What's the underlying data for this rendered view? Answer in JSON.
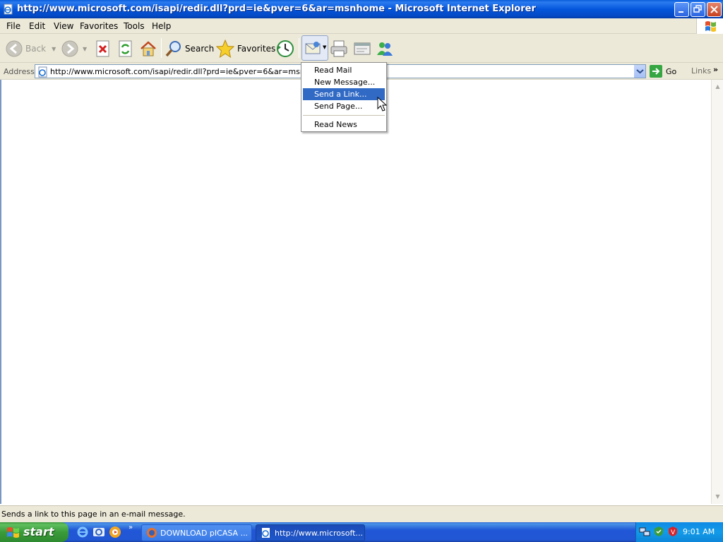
{
  "window": {
    "title": "http://www.microsoft.com/isapi/redir.dll?prd=ie&pver=6&ar=msnhome - Microsoft Internet Explorer",
    "controls": [
      "minimize",
      "restore",
      "close"
    ]
  },
  "menubar": {
    "items": [
      "File",
      "Edit",
      "View",
      "Favorites",
      "Tools",
      "Help"
    ]
  },
  "toolbar": {
    "back_label": "Back",
    "search_label": "Search",
    "favorites_label": "Favorites",
    "icons": [
      "back-arrow-icon",
      "forward-arrow-icon",
      "stop-icon",
      "refresh-icon",
      "home-icon",
      "search-icon",
      "favorites-star-icon",
      "history-icon",
      "mail-icon",
      "print-icon",
      "edit-icon",
      "messenger-icon"
    ]
  },
  "address": {
    "label": "Address",
    "url": "http://www.microsoft.com/isapi/redir.dll?prd=ie&pver=6&ar=msnhome",
    "go_label": "Go",
    "links_label": "Links"
  },
  "mail_menu": {
    "items": [
      "Read Mail",
      "New Message...",
      "Send a Link...",
      "Send Page...",
      "Read News"
    ],
    "selected": "Send a Link..."
  },
  "status": {
    "text": "Sends a link to this page in an e-mail message."
  },
  "taskbar": {
    "start_label": "start",
    "tasks": [
      {
        "label": "DOWNLOAD pICASA ...",
        "active": false
      },
      {
        "label": "http://www.microsoft...",
        "active": true
      }
    ],
    "clock": "9:01 AM"
  },
  "colors": {
    "titlebar": "#0556dc",
    "chrome": "#ece9d8",
    "menu_highlight": "#316ac5",
    "start_green": "#3a9b3a",
    "taskbar_blue": "#2157d7"
  }
}
